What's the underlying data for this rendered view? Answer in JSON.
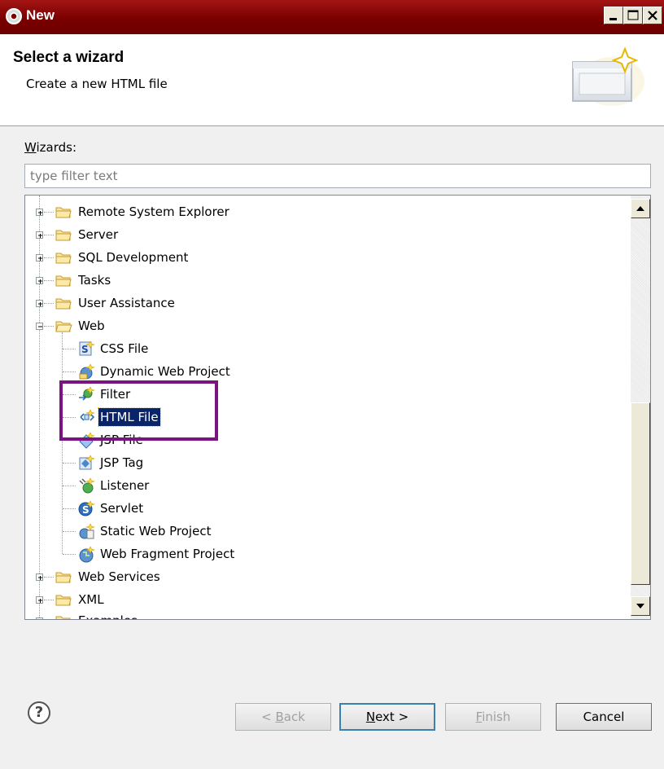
{
  "window": {
    "title": "New",
    "icon": "wizard-gear-icon"
  },
  "header": {
    "title": "Select a wizard",
    "description": "Create a new HTML file",
    "art": "new-file-wizard-icon"
  },
  "wizards": {
    "label_mnemonic": "W",
    "label_rest": "izards:",
    "filter_placeholder": "type filter text"
  },
  "tree": {
    "items": [
      {
        "label": "Remote System Explorer",
        "icon": "folder-icon",
        "expander": "plus"
      },
      {
        "label": "Server",
        "icon": "folder-icon",
        "expander": "plus"
      },
      {
        "label": "SQL Development",
        "icon": "folder-icon",
        "expander": "plus"
      },
      {
        "label": "Tasks",
        "icon": "folder-icon",
        "expander": "plus"
      },
      {
        "label": "User Assistance",
        "icon": "folder-icon",
        "expander": "plus"
      },
      {
        "label": "Web",
        "icon": "folder-open-icon",
        "expander": "minus"
      },
      {
        "label": "CSS File",
        "icon": "css-file-icon"
      },
      {
        "label": "Dynamic Web Project",
        "icon": "web-project-icon"
      },
      {
        "label": "Filter",
        "icon": "filter-icon"
      },
      {
        "label": "HTML File",
        "icon": "html-file-icon",
        "selected": true
      },
      {
        "label": "JSP File",
        "icon": "jsp-file-icon"
      },
      {
        "label": "JSP Tag",
        "icon": "jsp-tag-icon"
      },
      {
        "label": "Listener",
        "icon": "listener-icon"
      },
      {
        "label": "Servlet",
        "icon": "servlet-icon"
      },
      {
        "label": "Static Web Project",
        "icon": "static-project-icon"
      },
      {
        "label": "Web Fragment Project",
        "icon": "fragment-project-icon"
      },
      {
        "label": "Web Services",
        "icon": "folder-icon",
        "expander": "plus"
      },
      {
        "label": "XML",
        "icon": "folder-icon",
        "expander": "plus"
      },
      {
        "label": "Examples",
        "icon": "folder-icon",
        "expander": "plus"
      }
    ]
  },
  "buttons": {
    "help": "?",
    "back_mnemonic": "B",
    "back_pre": "< ",
    "back_rest": "ack",
    "next_mnemonic": "N",
    "next_rest": "ext >",
    "finish_mnemonic": "F",
    "finish_rest": "inish",
    "cancel": "Cancel"
  },
  "colors": {
    "titlebar": "#7a0000",
    "selection": "#0a246a",
    "highlight_box": "#7b1480"
  }
}
